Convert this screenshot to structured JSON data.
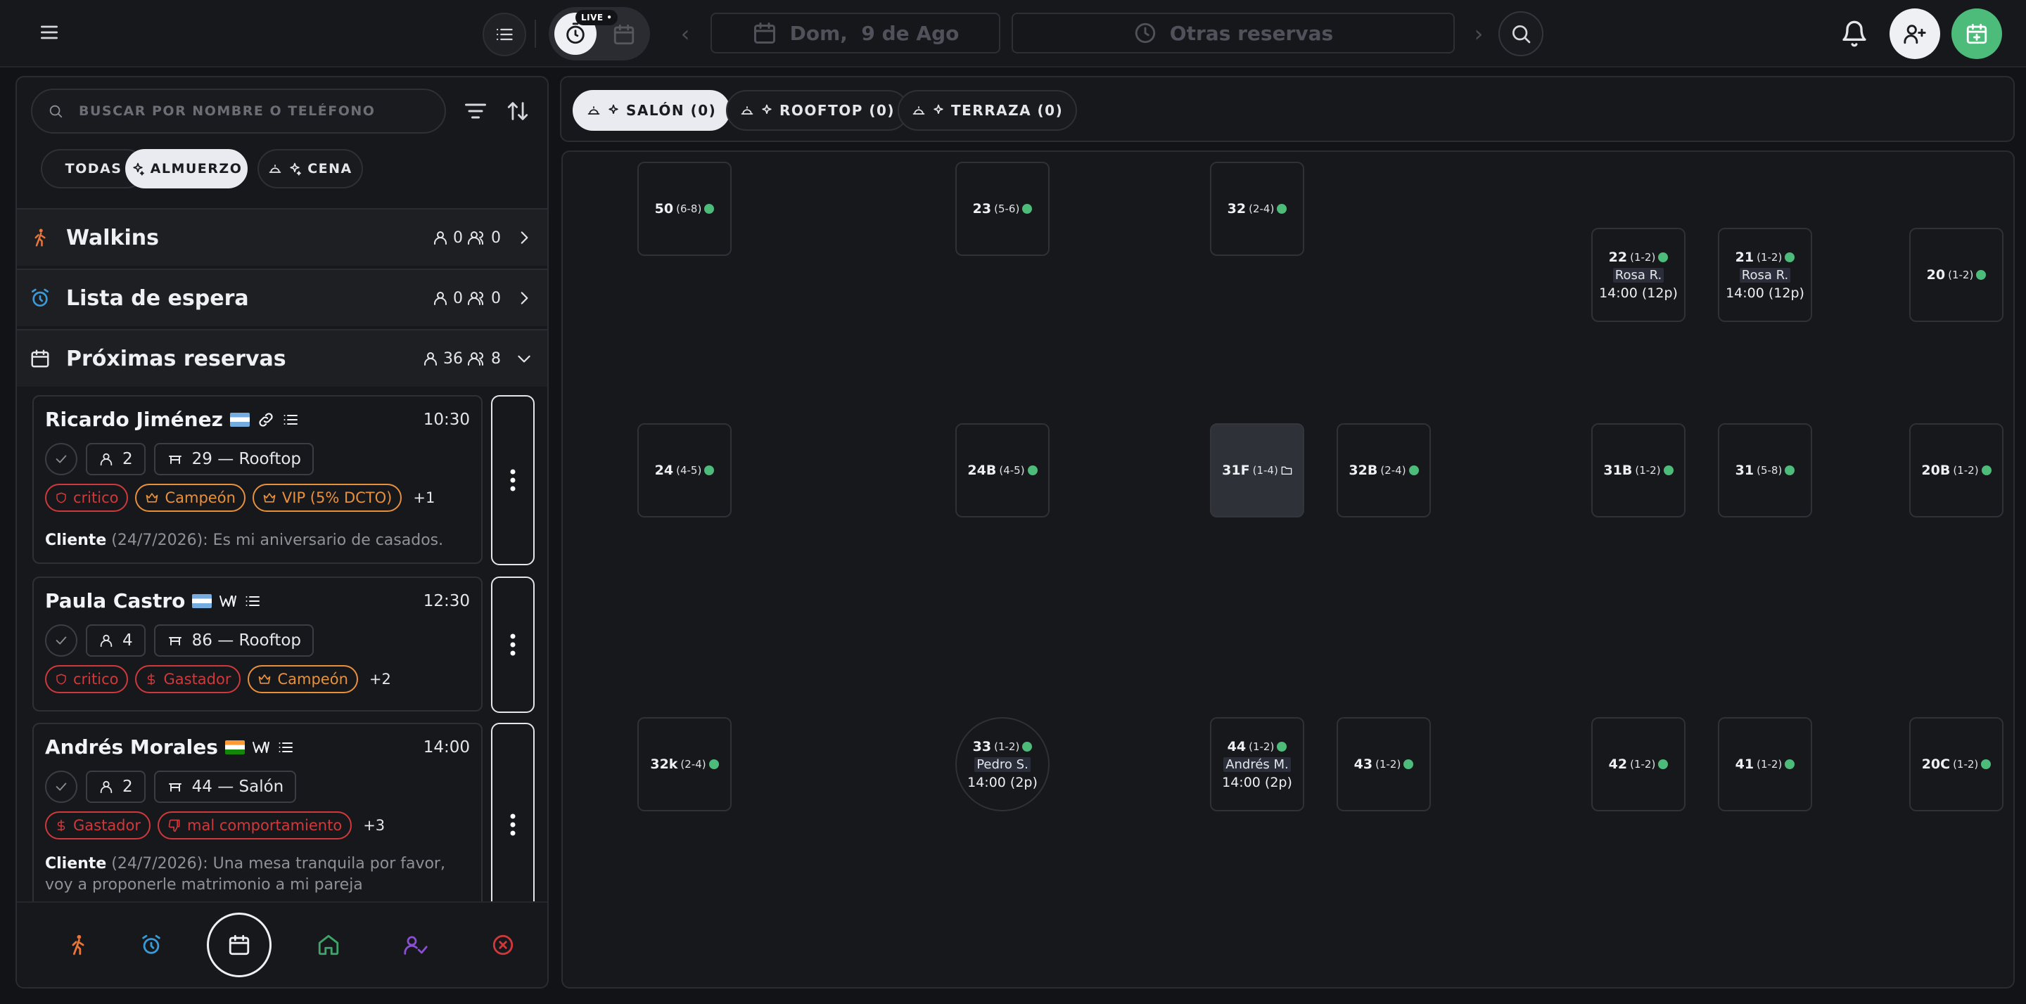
{
  "topbar": {
    "live_badge": "LIVE •",
    "date_label": "Dom,  9 de Ago",
    "other_reservations": "Otras reservas",
    "prev_arrow": "‹",
    "next_arrow": "›"
  },
  "left": {
    "search_placeholder": "BUSCAR POR NOMBRE O TELÉFONO",
    "filters": [
      "TODAS",
      "ALMUERZO",
      "CENA"
    ],
    "sections": {
      "walkins": {
        "title": "Walkins",
        "people": "0",
        "groups": "0"
      },
      "espera": {
        "title": "Lista de espera",
        "people": "0",
        "groups": "0"
      },
      "proximas": {
        "title": "Próximas reservas",
        "people": "36",
        "groups": "8"
      }
    },
    "reservations": [
      {
        "name": "Ricardo Jiménez",
        "time": "10:30",
        "guests": "2",
        "table": "29 — Rooftop",
        "tags": [
          "critico",
          "Campeón",
          "VIP (5% DCTO)",
          "+1"
        ],
        "note_author": "Cliente",
        "note_date": "(24/7/2026):",
        "note_text": "Es mi aniversario de casados."
      },
      {
        "name": "Paula Castro",
        "time": "12:30",
        "guests": "4",
        "table": "86 — Rooftop",
        "tags": [
          "critico",
          "Gastador",
          "Campeón",
          "+2"
        ]
      },
      {
        "name": "Andrés Morales",
        "time": "14:00",
        "guests": "2",
        "table": "44 — Salón",
        "tags": [
          "Gastador",
          "mal comportamiento",
          "+3"
        ],
        "note_author": "Cliente",
        "note_date": "(24/7/2026):",
        "note_text": "Una mesa tranquila por favor, voy a proponerle matrimonio a mi pareja"
      }
    ]
  },
  "zones": [
    "SALÓN (0)",
    "ROOFTOP (0)",
    "TERRAZA (0)"
  ],
  "tables": {
    "t50": {
      "num": "50",
      "cap": "(6-8)"
    },
    "t23": {
      "num": "23",
      "cap": "(5-6)"
    },
    "t32": {
      "num": "32",
      "cap": "(2-4)"
    },
    "t22": {
      "num": "22",
      "cap": "(1-2)",
      "guest": "Rosa R.",
      "time": "14:00 (12p)"
    },
    "t21": {
      "num": "21",
      "cap": "(1-2)",
      "guest": "Rosa R.",
      "time": "14:00 (12p)"
    },
    "t20": {
      "num": "20",
      "cap": "(1-2)"
    },
    "t24": {
      "num": "24",
      "cap": "(4-5)"
    },
    "t24b": {
      "num": "24B",
      "cap": "(4-5)"
    },
    "t31f": {
      "num": "31F",
      "cap": "(1-4)"
    },
    "t32b": {
      "num": "32B",
      "cap": "(2-4)"
    },
    "t31b": {
      "num": "31B",
      "cap": "(1-2)"
    },
    "t31": {
      "num": "31",
      "cap": "(5-8)"
    },
    "t20b": {
      "num": "20B",
      "cap": "(1-2)"
    },
    "t32k": {
      "num": "32k",
      "cap": "(2-4)"
    },
    "t33": {
      "num": "33",
      "cap": "(1-2)",
      "guest": "Pedro S.",
      "time": "14:00 (2p)"
    },
    "t44": {
      "num": "44",
      "cap": "(1-2)",
      "guest": "Andrés M.",
      "time": "14:00 (2p)"
    },
    "t43": {
      "num": "43",
      "cap": "(1-2)"
    },
    "t42": {
      "num": "42",
      "cap": "(1-2)"
    },
    "t41": {
      "num": "41",
      "cap": "(1-2)"
    },
    "t20c": {
      "num": "20C",
      "cap": "(1-2)"
    }
  },
  "colors": {
    "accent_green": "#4dbb7a",
    "tag_red": "#d0393b",
    "tag_orange": "#e8913d",
    "walkin_orange": "#e8763a",
    "waitlist_blue": "#3a9bd8",
    "home_green": "#3fa56b",
    "user_purple": "#8b4fd6",
    "cancel_red": "#d0393b"
  },
  "icons": [
    "menu-icon",
    "list-icon",
    "timer-icon",
    "calendar-icon",
    "clock-icon",
    "search-icon",
    "bell-icon",
    "user-plus-icon",
    "calendar-plus-icon",
    "filter-icon",
    "sort-icon",
    "walk-icon",
    "alarm-icon",
    "chevron-right-icon",
    "chevron-down-icon",
    "user-icon",
    "users-icon",
    "check-icon",
    "table-icon",
    "link-icon",
    "shield-icon",
    "crown-icon",
    "dollar-icon",
    "thumbs-down-icon",
    "kebab-icon",
    "home-icon",
    "user-check-icon",
    "cancel-icon",
    "bell-service-icon",
    "sparkle-icon"
  ]
}
